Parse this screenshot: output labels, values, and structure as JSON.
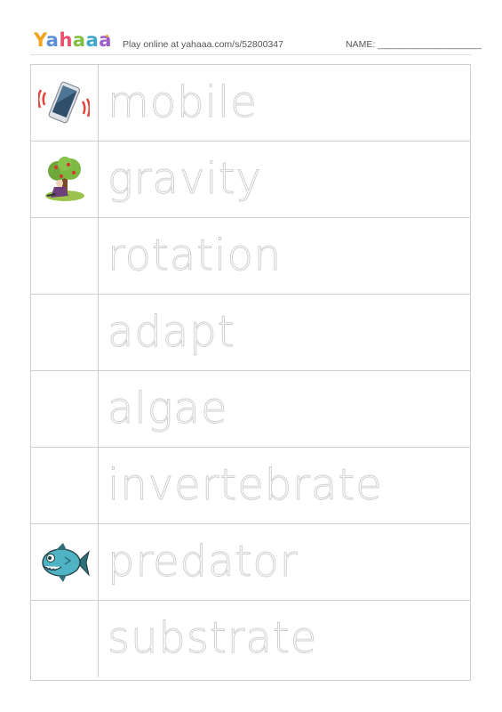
{
  "header": {
    "logo": [
      "Y",
      "a",
      "h",
      "a",
      "a",
      "a"
    ],
    "tagline": "Play online at yahaaa.com/s/52800347",
    "name_label": "NAME: ____________________"
  },
  "rows": [
    {
      "word": "mobile",
      "icon": "mobile-phone-icon"
    },
    {
      "word": "gravity",
      "icon": "apple-tree-icon"
    },
    {
      "word": "rotation",
      "icon": ""
    },
    {
      "word": "adapt",
      "icon": ""
    },
    {
      "word": "algae",
      "icon": ""
    },
    {
      "word": "invertebrate",
      "icon": ""
    },
    {
      "word": "predator",
      "icon": "piranha-fish-icon"
    },
    {
      "word": "substrate",
      "icon": ""
    }
  ],
  "colors": {
    "grid_line": "#cfcfcf",
    "trace_text": "#cdcdcd"
  }
}
